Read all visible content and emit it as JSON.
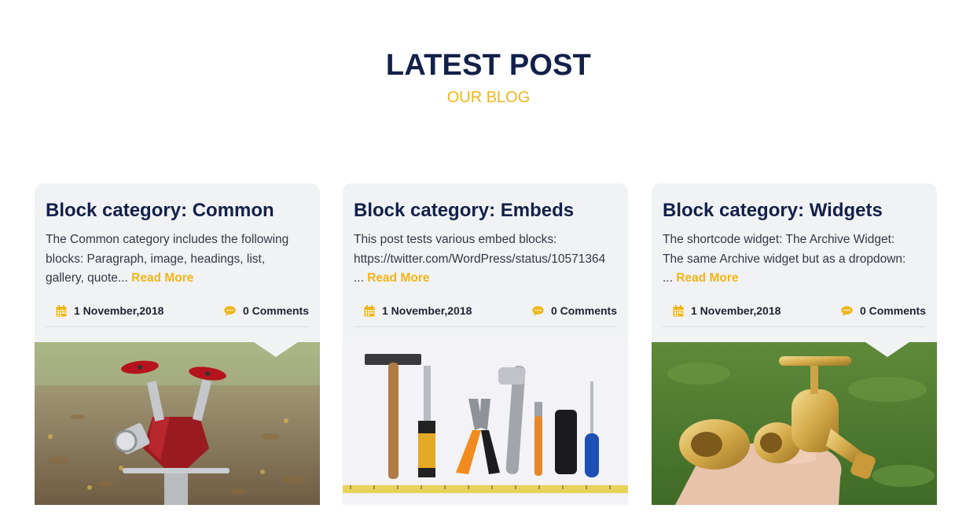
{
  "section": {
    "title": "LATEST POST",
    "subtitle": "OUR BLOG"
  },
  "colors": {
    "heading": "#13204a",
    "accent": "#f0b518",
    "card_bg": "#f1f2f4"
  },
  "posts": [
    {
      "title": "Block category: Common",
      "excerpt_lines": [
        "The Common category includes the following",
        "blocks: Paragraph, image, headings, list,",
        "gallery, quote..."
      ],
      "read_more": "Read More",
      "date": "1 November,2018",
      "comments": "0 Comments",
      "date_icon": "calendar-icon",
      "comments_icon": "speech-bubble-icon",
      "image": "fire-hydrant-photo"
    },
    {
      "title": "Block category: Embeds",
      "excerpt_lines": [
        "This post tests various embed blocks:",
        "https://twitter.com/WordPress/status/10571364",
        "..."
      ],
      "read_more": "Read More",
      "date": "1 November,2018",
      "comments": "0 Comments",
      "date_icon": "calendar-icon",
      "comments_icon": "speech-bubble-icon",
      "image": "tools-photo"
    },
    {
      "title": "Block category: Widgets",
      "excerpt_lines": [
        "The shortcode widget: The Archive Widget:",
        "The same Archive widget but as a dropdown:",
        "..."
      ],
      "read_more": "Read More",
      "date": "1 November,2018",
      "comments": "0 Comments",
      "date_icon": "calendar-icon",
      "comments_icon": "speech-bubble-icon",
      "image": "brass-faucet-photo"
    }
  ]
}
